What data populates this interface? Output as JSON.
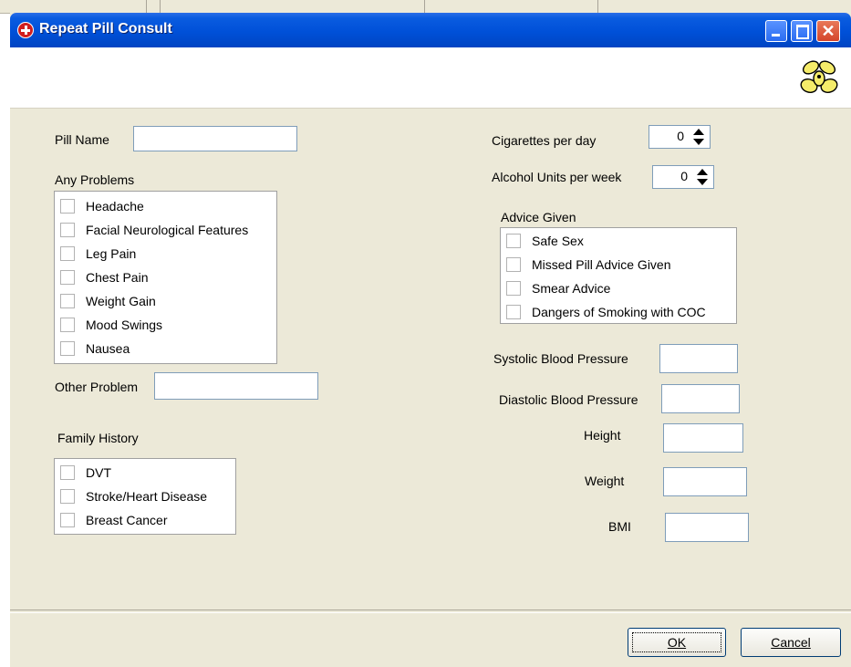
{
  "window": {
    "title": "Repeat Pill Consult"
  },
  "colors": {
    "titlebar": "#0050d8",
    "dialog_bg": "#ece9d8",
    "close_button": "#d4452a"
  },
  "icons": {
    "app": "red-cross-icon",
    "logo": "yellow-flower-icon"
  },
  "left": {
    "pill_name_label": "Pill Name",
    "pill_name_value": "",
    "any_problems_label": "Any Problems",
    "problems": [
      "Headache",
      "Facial Neurological Features",
      "Leg Pain",
      "Chest Pain",
      "Weight Gain",
      "Mood Swings",
      "Nausea"
    ],
    "other_problem_label": "Other Problem",
    "other_problem_value": "",
    "family_history_label": "Family History",
    "family_history": [
      "DVT",
      "Stroke/Heart Disease",
      "Breast Cancer"
    ]
  },
  "right": {
    "cigarettes_label": "Cigarettes per day",
    "cigarettes_value": "0",
    "alcohol_label": "Alcohol Units per week",
    "alcohol_value": "0",
    "advice_label": "Advice Given",
    "advice": [
      "Safe Sex",
      "Missed Pill Advice Given",
      "Smear Advice",
      "Dangers of Smoking with COC"
    ],
    "systolic_label": "Systolic Blood Pressure",
    "diastolic_label": "Diastolic Blood Pressure",
    "height_label": "Height",
    "weight_label": "Weight",
    "bmi_label": "BMI"
  },
  "footer": {
    "ok_label": "OK",
    "cancel_label": "Cancel"
  }
}
